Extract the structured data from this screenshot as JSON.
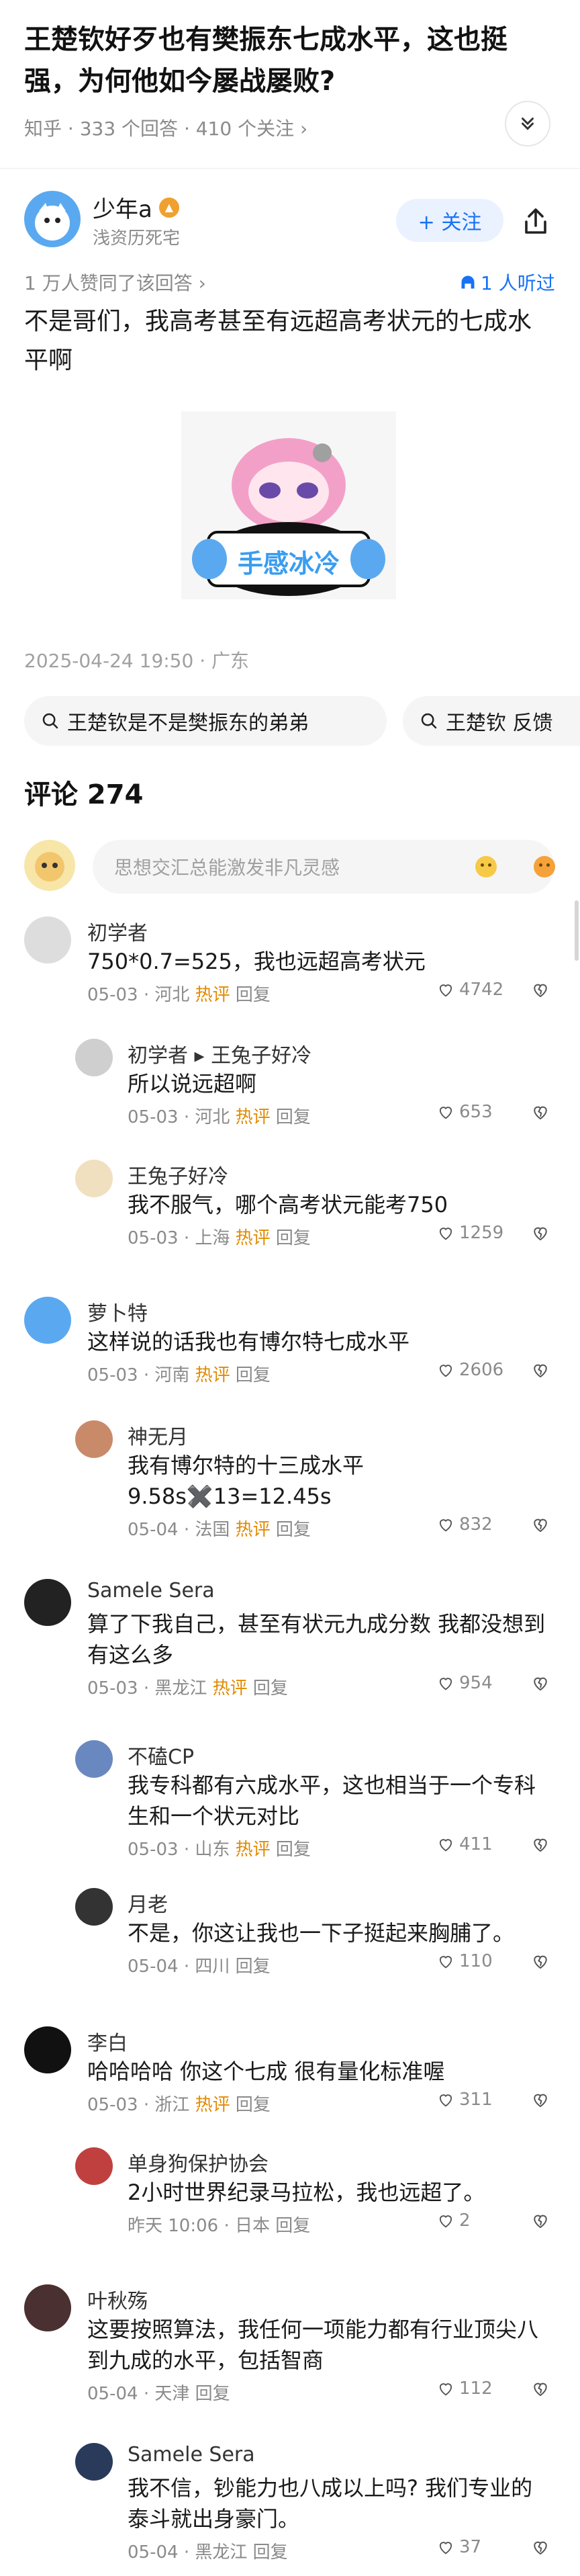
{
  "question": {
    "title": "王楚钦好歹也有樊振东七成水平，这也挺强，为何他如今屡战屡败?",
    "meta": "知乎 · 333 个回答 · 410 个关注 ›"
  },
  "author": {
    "name": "少年a",
    "subtitle": "浅资历死宅",
    "follow_label": "+ 关注"
  },
  "answer": {
    "votes": "1 万人赞同了该回答 ›",
    "listened": "1 人听过",
    "text": "不是哥们，我高考甚至有远超高考状元的七成水平啊",
    "sticker_text": "手感冰冷",
    "time": "2025-04-24 19:50 · 广东"
  },
  "chips": [
    {
      "label": "王楚钦是不是樊振东的弟弟"
    },
    {
      "label": "王楚钦 反馈"
    }
  ],
  "comments": {
    "header": "评论 274",
    "input_placeholder": "思想交汇总能激发非凡灵感",
    "hot_label": "热评",
    "reply_label": "回复",
    "items": [
      {
        "name": "初学者",
        "text": "750*0.7=525，我也远超高考状元",
        "date": "05-03",
        "loc": "河北",
        "hot": true,
        "likes": "4742"
      },
      {
        "name": "初学者 ▸ 王兔子好冷",
        "text": "所以说远超啊",
        "date": "05-03",
        "loc": "河北",
        "hot": true,
        "likes": "653"
      },
      {
        "name": "王兔子好冷",
        "text": "我不服气，哪个高考状元能考750",
        "date": "05-03",
        "loc": "上海",
        "hot": true,
        "likes": "1259"
      },
      {
        "name": "萝卜特",
        "text": "这样说的话我也有博尔特七成水平",
        "date": "05-03",
        "loc": "河南",
        "hot": true,
        "likes": "2606"
      },
      {
        "name": "神无月",
        "text": "我有博尔特的十三成水平\n9.58s✖️13=12.45s",
        "date": "05-04",
        "loc": "法国",
        "hot": true,
        "likes": "832"
      },
      {
        "name": "Samele Sera",
        "text": "算了下我自己，甚至有状元九成分数 我都没想到有这么多",
        "date": "05-03",
        "loc": "黑龙江",
        "hot": true,
        "likes": "954"
      },
      {
        "name": "不磕CP",
        "text": "我专科都有六成水平，这也相当于一个专科生和一个状元对比",
        "date": "05-03",
        "loc": "山东",
        "hot": true,
        "likes": "411"
      },
      {
        "name": "月老",
        "text": "不是，你这让我也一下子挺起来胸脯了。",
        "date": "05-04",
        "loc": "四川",
        "hot": false,
        "likes": "110"
      },
      {
        "name": "李白",
        "text": "哈哈哈哈 你这个七成 很有量化标准喔",
        "date": "05-03",
        "loc": "浙江",
        "hot": true,
        "likes": "311"
      },
      {
        "name": "单身狗保护协会",
        "text": "2小时世界纪录马拉松，我也远超了。",
        "date": "昨天 10:06",
        "loc": "日本",
        "hot": false,
        "likes": "2"
      },
      {
        "name": "叶秋殇",
        "text": "这要按照算法，我任何一项能力都有行业顶尖八到九成的水平，包括智商",
        "date": "05-04",
        "loc": "天津",
        "hot": false,
        "likes": "112"
      },
      {
        "name": "Samele Sera",
        "text": "我不信，钞能力也八成以上吗? 我们专业的泰斗就出身豪门。",
        "date": "05-04",
        "loc": "黑龙江",
        "hot": false,
        "likes": "37"
      }
    ]
  },
  "icons": {
    "collapse": "chevron-double-down-icon",
    "share": "share-icon",
    "headphones": "headphones-icon",
    "search": "search-icon",
    "like": "heart-icon",
    "dislike": "broken-heart-icon",
    "accent": "#1772f6"
  }
}
